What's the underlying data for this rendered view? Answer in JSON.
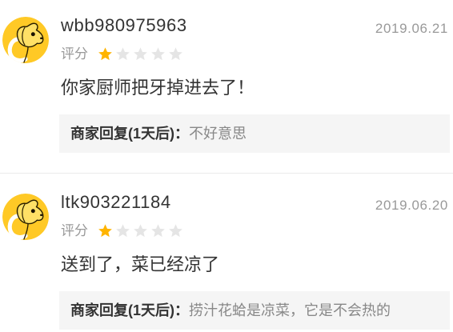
{
  "colors": {
    "text_primary": "#333333",
    "text_secondary": "#999999",
    "text_reply": "#888888",
    "reply_bg": "#F5F5F5",
    "divider": "#EBEBEB",
    "star_filled": "#FFB400",
    "star_empty": "#E5E5E5",
    "avatar_bg": "#FFC926"
  },
  "icons": {
    "avatar": "dog-avatar-icon",
    "star": "star-icon"
  },
  "reviews": [
    {
      "username": "wbb980975963",
      "date": "2019.06.21",
      "rating_label": "评分",
      "rating": {
        "value": 1,
        "max": 5
      },
      "content": "你家厨师把牙掉进去了！",
      "reply": {
        "label": "商家回复(1天后)：",
        "text": "不好意思"
      }
    },
    {
      "username": "ltk903221184",
      "date": "2019.06.20",
      "rating_label": "评分",
      "rating": {
        "value": 1,
        "max": 5
      },
      "content": "送到了，菜已经凉了",
      "reply": {
        "label": "商家回复(1天后)：",
        "text": "捞汁花蛤是凉菜，它是不会热的"
      }
    }
  ]
}
